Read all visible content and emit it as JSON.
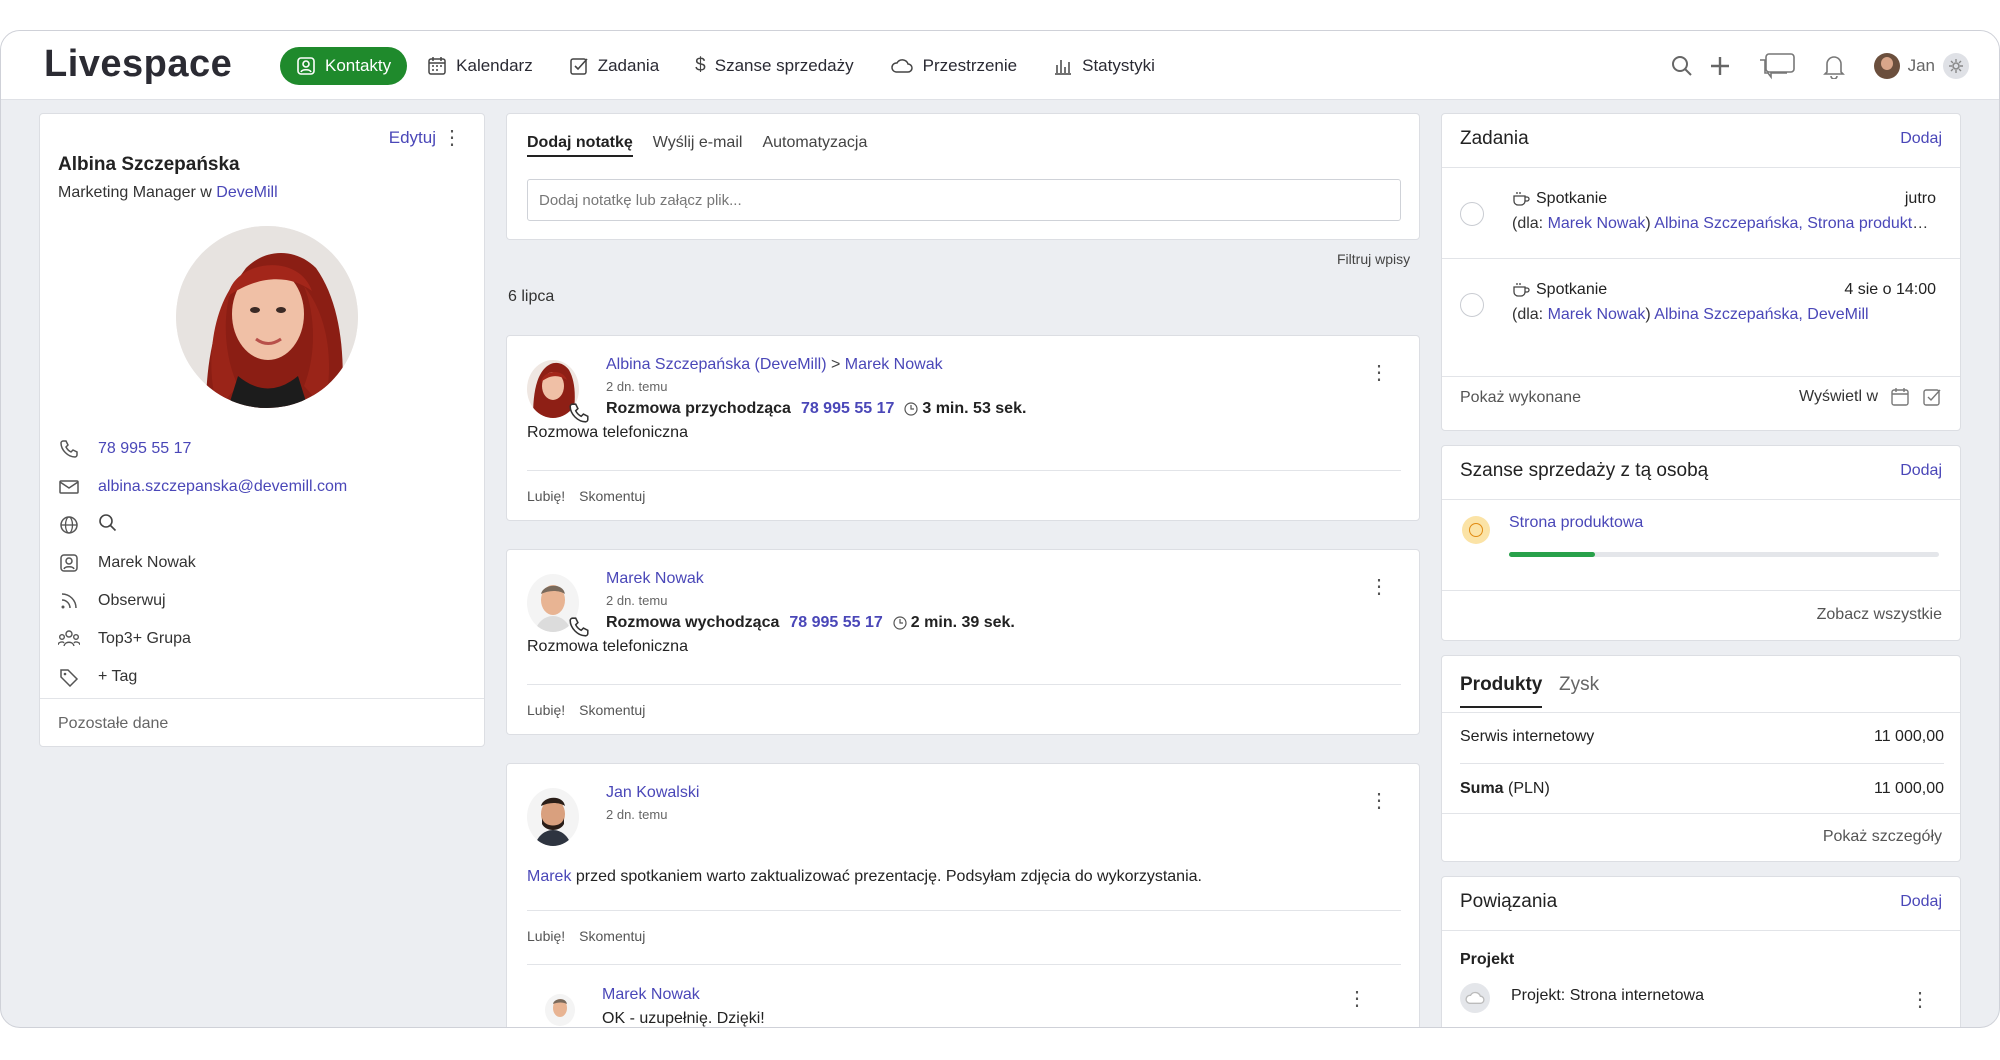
{
  "app": {
    "logo": "Livespace"
  },
  "nav": [
    {
      "label": "Kontakty",
      "icon": "contact-icon",
      "active": true
    },
    {
      "label": "Kalendarz",
      "icon": "calendar-icon"
    },
    {
      "label": "Zadania",
      "icon": "task-check-icon"
    },
    {
      "label": "Szanse sprzedaży",
      "icon": "dollar-icon"
    },
    {
      "label": "Przestrzenie",
      "icon": "cloud-icon"
    },
    {
      "label": "Statystyki",
      "icon": "bar-chart-icon"
    }
  ],
  "user": {
    "name": "Jan"
  },
  "profile": {
    "edit": "Edytuj",
    "name": "Albina Szczepańska",
    "role_prefix": "Marketing Manager w",
    "company": "DeveMill",
    "phone": "78 995 55 17",
    "email": "albina.szczepanska@devemill.com",
    "owner": "Marek Nowak",
    "follow": "Obserwuj",
    "group": "Top3+ Grupa",
    "tag": "+ Tag",
    "more": "Pozostałe dane"
  },
  "composer": {
    "tabs": [
      "Dodaj notatkę",
      "Wyślij e-mail",
      "Automatyzacja"
    ],
    "placeholder": "Dodaj notatkę lub załącz plik..."
  },
  "feed": {
    "filter": "Filtruj wpisy",
    "date": "6 lipca",
    "like": "Lubię!",
    "comment": "Skomentuj",
    "entries": [
      {
        "author": "Albina Szczepańska (DeveMill)",
        "sep": ">",
        "target": "Marek Nowak",
        "time": "2 dn. temu",
        "call_type": "Rozmowa przychodząca",
        "number": "78 995 55 17",
        "duration": "3 min. 53 sek.",
        "body": "Rozmowa telefoniczna"
      },
      {
        "author": "Marek Nowak",
        "time": "2 dn. temu",
        "call_type": "Rozmowa wychodząca",
        "number": "78 995 55 17",
        "duration": "2 min. 39 sek.",
        "body": "Rozmowa telefoniczna"
      },
      {
        "author": "Jan Kowalski",
        "time": "2 dn. temu",
        "mention": "Marek",
        "body": "przed spotkaniem warto zaktualizować prezentację. Podsyłam zdjęcia do wykorzystania.",
        "reply_author": "Marek Nowak",
        "reply_body": "OK - uzupełnię. Dzięki!"
      }
    ]
  },
  "tasks": {
    "title": "Zadania",
    "add": "Dodaj",
    "items": [
      {
        "title": "Spotkanie",
        "when": "jutro",
        "for_prefix": "(dla:",
        "for_user": "Marek Nowak",
        "for_rest": "Albina Szczepańska, Strona produktowa"
      },
      {
        "title": "Spotkanie",
        "when": "4 sie o 14:00",
        "for_prefix": "(dla:",
        "for_user": "Marek Nowak",
        "for_rest": "Albina Szczepańska, DeveMill"
      }
    ],
    "show_done": "Pokaż wykonane",
    "view_in": "Wyświetl w"
  },
  "deals": {
    "title": "Szanse sprzedaży z tą osobą",
    "add": "Dodaj",
    "item": "Strona produktowa",
    "progress": 0.2,
    "see_all": "Zobacz wszystkie",
    "colors": {
      "progress": "#28a14a"
    }
  },
  "products": {
    "tabs": [
      "Produkty",
      "Zysk"
    ],
    "rows": [
      {
        "name": "Serwis internetowy",
        "value": "11 000,00"
      }
    ],
    "sum_label": "Suma",
    "sum_unit": "(PLN)",
    "sum_value": "11 000,00",
    "details": "Pokaż szczegóły"
  },
  "links": {
    "title": "Powiązania",
    "add": "Dodaj",
    "section": "Projekt",
    "item": "Projekt: Strona internetowa"
  }
}
